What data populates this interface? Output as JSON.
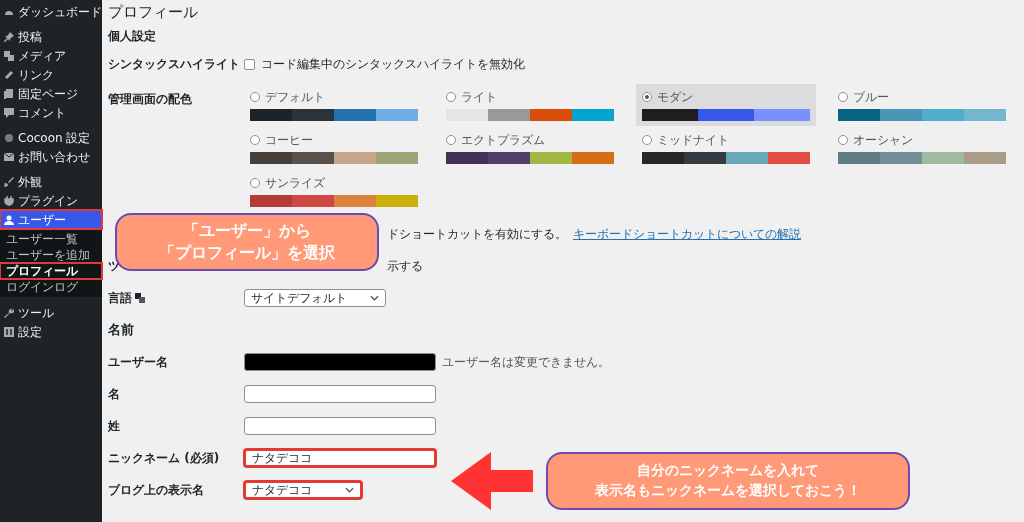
{
  "sidebar": {
    "groups": [
      {
        "items": [
          {
            "label": "ダッシュボード",
            "selected": false,
            "highlighted": false
          }
        ]
      },
      {
        "items": [
          {
            "label": "投稿",
            "selected": false,
            "highlighted": false
          },
          {
            "label": "メディア",
            "selected": false,
            "highlighted": false
          },
          {
            "label": "リンク",
            "selected": false,
            "highlighted": false
          },
          {
            "label": "固定ページ",
            "selected": false,
            "highlighted": false
          },
          {
            "label": "コメント",
            "selected": false,
            "highlighted": false
          }
        ]
      },
      {
        "items": [
          {
            "label": "Cocoon 設定",
            "selected": false,
            "highlighted": false
          },
          {
            "label": "お問い合わせ",
            "selected": false,
            "highlighted": false
          }
        ]
      },
      {
        "items": [
          {
            "label": "外観",
            "selected": false,
            "highlighted": false
          },
          {
            "label": "プラグイン",
            "selected": false,
            "highlighted": false
          },
          {
            "label": "ユーザー",
            "selected": true,
            "highlighted": true,
            "children": [
              {
                "label": "ユーザー一覧",
                "selected": false,
                "highlighted": false
              },
              {
                "label": "ユーザーを追加",
                "selected": false,
                "highlighted": false
              },
              {
                "label": "プロフィール",
                "selected": true,
                "highlighted": true
              },
              {
                "label": "ログインログ",
                "selected": false,
                "highlighted": false
              }
            ]
          }
        ]
      },
      {
        "items": [
          {
            "label": "ツール",
            "selected": false,
            "highlighted": false
          },
          {
            "label": "設定",
            "selected": false,
            "highlighted": false
          }
        ]
      }
    ]
  },
  "title": "プロフィール",
  "section_heading": "個人設定",
  "rows": [
    {
      "kind": "checkbox",
      "label": "シンタックスハイライト",
      "text": "コード編集中のシンタックスハイライトを無効化",
      "checked": false
    },
    {
      "kind": "schemes",
      "label": "管理画面の配色",
      "schemes": [
        {
          "label": "デフォルト",
          "selected": false,
          "swatches": [
            {
              "color": "#1d2327"
            },
            {
              "color": "#2c3338"
            },
            {
              "color": "#2271b1"
            },
            {
              "color": "#72aee6"
            }
          ]
        },
        {
          "label": "ライト",
          "selected": false,
          "swatches": [
            {
              "color": "#e5e5e5"
            },
            {
              "color": "#999999"
            },
            {
              "color": "#d64e07"
            },
            {
              "color": "#04a4cc"
            }
          ]
        },
        {
          "label": "モダン",
          "selected": true,
          "swatches": [
            {
              "color": "#1e1e1e"
            },
            {
              "color": "#3858e9"
            },
            {
              "color": "#7b90ff"
            }
          ]
        },
        {
          "label": "ブルー",
          "selected": false,
          "swatches": [
            {
              "color": "#096484"
            },
            {
              "color": "#4796b3"
            },
            {
              "color": "#52accc"
            },
            {
              "color": "#74b6ce"
            }
          ]
        },
        {
          "label": "コーヒー",
          "selected": false,
          "swatches": [
            {
              "color": "#46403c"
            },
            {
              "color": "#59524c"
            },
            {
              "color": "#c7a589"
            },
            {
              "color": "#9ea476"
            }
          ]
        },
        {
          "label": "エクトプラズム",
          "selected": false,
          "swatches": [
            {
              "color": "#413256"
            },
            {
              "color": "#523f6d"
            },
            {
              "color": "#a3b745"
            },
            {
              "color": "#d46f15"
            }
          ]
        },
        {
          "label": "ミッドナイト",
          "selected": false,
          "swatches": [
            {
              "color": "#25282b"
            },
            {
              "color": "#363b3f"
            },
            {
              "color": "#69a8bb"
            },
            {
              "color": "#e14d43"
            }
          ]
        },
        {
          "label": "オーシャン",
          "selected": false,
          "swatches": [
            {
              "color": "#627c83"
            },
            {
              "color": "#738e96"
            },
            {
              "color": "#9ebaa0"
            },
            {
              "color": "#aa9d88"
            }
          ]
        },
        {
          "label": "サンライズ",
          "selected": false,
          "swatches": [
            {
              "color": "#b43c38"
            },
            {
              "color": "#cf4944"
            },
            {
              "color": "#dd823b"
            },
            {
              "color": "#ccaf0b"
            }
          ]
        }
      ]
    },
    {
      "kind": "partial",
      "text": "ドショートカットを有効にする。",
      "link": "キーボードショートカットについての解説"
    },
    {
      "kind": "partial",
      "label": "ツ",
      "text": "示する"
    },
    {
      "kind": "select",
      "label": "言語",
      "value": "サイトデフォルト",
      "label_icon": true,
      "highlighted": false
    },
    {
      "kind": "heading",
      "label": "名前"
    },
    {
      "kind": "text",
      "label": "ユーザー名",
      "redacted": true,
      "note": "ユーザー名は変更できません。",
      "highlighted": false
    },
    {
      "kind": "text",
      "label": "名",
      "highlighted": false
    },
    {
      "kind": "text",
      "label": "姓",
      "highlighted": false
    },
    {
      "kind": "text",
      "label": "ニックネーム (必須)",
      "value": "ナタデココ",
      "highlighted": true
    },
    {
      "kind": "select",
      "label": "ブログ上の表示名",
      "value": "ナタデココ",
      "highlighted": true
    }
  ],
  "callouts": [
    {
      "lines": [
        "「ユーザー」から",
        "「プロフィール」を選択"
      ]
    },
    {
      "lines": [
        "自分のニックネームを入れて",
        "表示名もニックネームを選択しておこう！"
      ]
    }
  ],
  "pointer_arrows": [
    {
      "kind": "left"
    }
  ]
}
